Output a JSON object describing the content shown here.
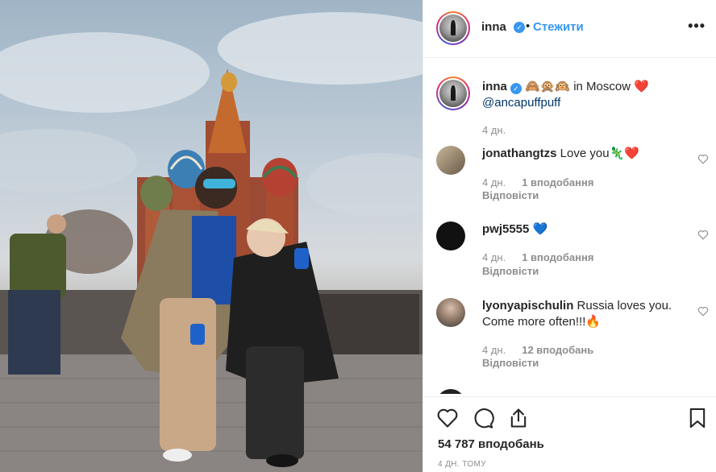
{
  "header": {
    "username": "inna",
    "separator": "•",
    "follow_label": "Стежити",
    "more_label": "•••"
  },
  "caption": {
    "username": "inna",
    "emojis": "🙈🙊🙉",
    "text": " in Moscow ",
    "heart": "❤️",
    "mention": "@ancapuffpuff",
    "time": "4 дн."
  },
  "comments": [
    {
      "username": "jonathangtzs",
      "text": "Love you🦎❤️",
      "time": "4 дн.",
      "likes": "1 вподобання",
      "reply_label": "Відповісти"
    },
    {
      "username": "pwj5555",
      "text": "💙",
      "time": "4 дн.",
      "likes": "1 вподобання",
      "reply_label": "Відповісти"
    },
    {
      "username": "lyonyapischulin",
      "text": "Russia loves you. Come more often!!!🔥",
      "time": "4 дн.",
      "likes": "12 вподобань",
      "reply_label": "Відповісти"
    }
  ],
  "footer": {
    "likes_count": "54 787 вподобань",
    "post_date": "4 ДН. ТОМУ"
  },
  "colors": {
    "link_blue": "#3897f0",
    "muted": "#8e8e8e",
    "text": "#262626",
    "border": "#efefef"
  },
  "icons": [
    "heart-icon",
    "comment-icon",
    "share-icon",
    "bookmark-icon",
    "more-options-icon",
    "verified-badge-icon"
  ]
}
